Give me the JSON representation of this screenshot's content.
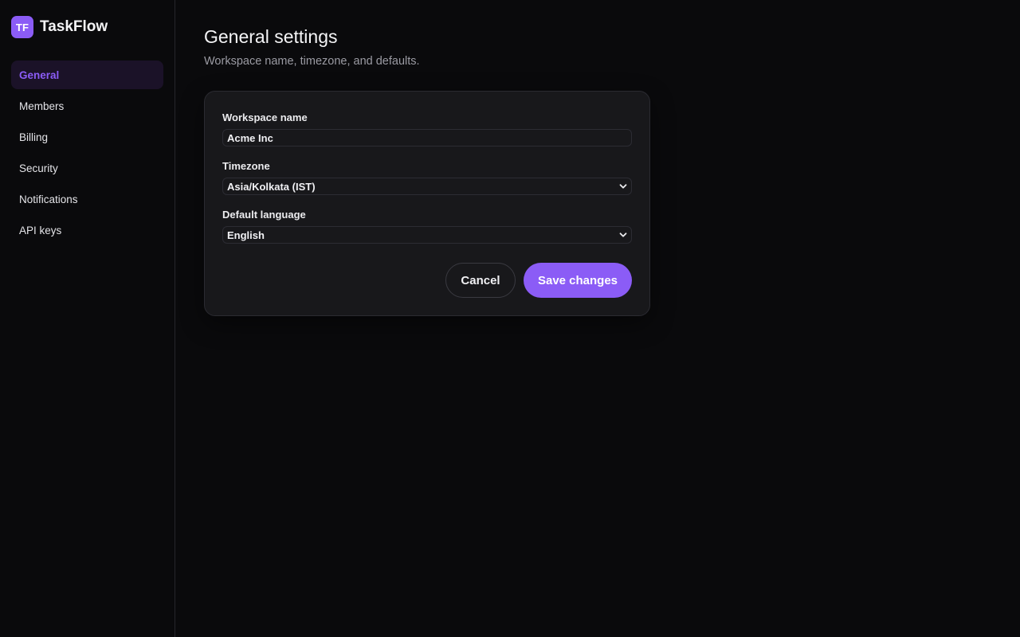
{
  "app": {
    "logo_text": "TF",
    "name": "TaskFlow"
  },
  "colors": {
    "accent": "#8b5cf6",
    "background": "#0a0a0c",
    "card": "#18181b",
    "active_nav_bg": "#1b1228"
  },
  "sidebar": {
    "items": [
      {
        "label": "General",
        "active": true
      },
      {
        "label": "Members",
        "active": false
      },
      {
        "label": "Billing",
        "active": false
      },
      {
        "label": "Security",
        "active": false
      },
      {
        "label": "Notifications",
        "active": false
      },
      {
        "label": "API keys",
        "active": false
      }
    ]
  },
  "page": {
    "title": "General settings",
    "subtitle": "Workspace name, timezone, and defaults."
  },
  "form": {
    "workspace_name": {
      "label": "Workspace name",
      "value": "Acme Inc"
    },
    "timezone": {
      "label": "Timezone",
      "value": "Asia/Kolkata (IST)",
      "icon": "chevron-down-icon"
    },
    "language": {
      "label": "Default language",
      "value": "English",
      "icon": "chevron-down-icon"
    },
    "cancel_label": "Cancel",
    "save_label": "Save changes"
  }
}
